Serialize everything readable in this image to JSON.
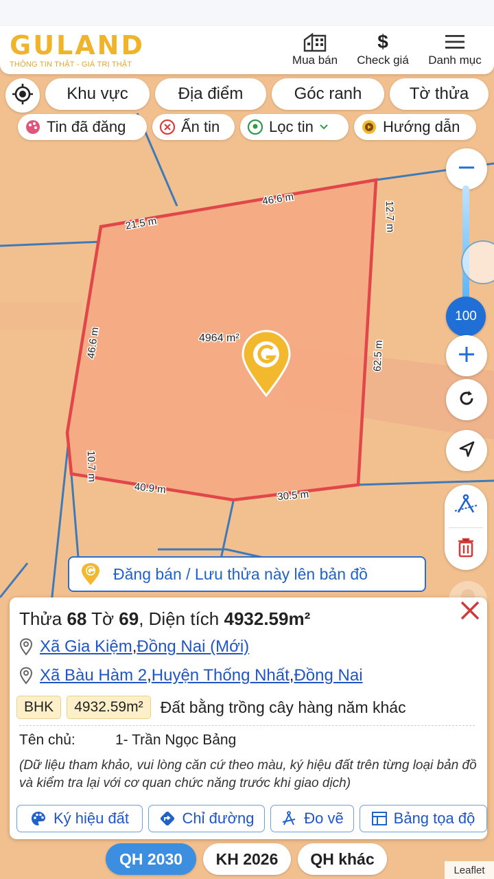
{
  "header": {
    "logo_text": "GULAND",
    "logo_tagline": "THÔNG TIN THẬT - GIÁ TRỊ THẬT",
    "nav": [
      {
        "label": "Mua bán",
        "icon": "building-icon"
      },
      {
        "label": "Check giá",
        "icon": "dollar-icon"
      },
      {
        "label": "Danh mục",
        "icon": "menu-icon"
      }
    ]
  },
  "filters": {
    "pills": [
      "Khu vực",
      "Địa điểm",
      "Góc ranh",
      "Tờ thửa"
    ],
    "chips": [
      {
        "label": "Tin đã đăng",
        "icon": "palette-icon"
      },
      {
        "label": "Ẩn tin",
        "icon": "close-circle-icon"
      },
      {
        "label": "Lọc tin",
        "icon": "location-pin-icon"
      },
      {
        "label": "Hướng dẫn",
        "icon": "play-circle-icon"
      }
    ]
  },
  "map": {
    "area_label": "4964 m²",
    "edges": [
      "46.6 m",
      "12.7 m",
      "21.5 m",
      "46.6 m",
      "62.5 m",
      "10.7 m",
      "40.9 m",
      "30.5 m"
    ],
    "zoom_level": "100",
    "parcel_color": "#f5a882",
    "parcel_border": "#e0464a",
    "attribution": "Leaflet"
  },
  "post_button": {
    "label": "Đăng bán / Lưu thửa này lên bản đồ"
  },
  "panel": {
    "title_prefix": "Thửa ",
    "plot_no": "68",
    "title_mid": " Tờ ",
    "sheet_no": "69",
    "title_area_label": ", Diện tích ",
    "area": "4932.59m²",
    "address_new": {
      "commune": "Xã Gia Kiệm",
      "sep": ", ",
      "province": "Đồng Nai (Mới)"
    },
    "address_old": {
      "commune": "Xã Bàu Hàm 2",
      "sep1": ", ",
      "district": "Huyện Thống Nhất",
      "sep2": ", ",
      "province": "Đồng Nai"
    },
    "land_code": "BHK",
    "land_area": "4932.59m²",
    "land_desc": "Đất bằng trồng cây hàng năm khác",
    "owner_label": "Tên chủ:",
    "owner_value": "1- Trần Ngọc Bảng",
    "note": "(Dữ liệu tham khảo, vui lòng căn cứ theo màu, ký hiệu đất trên từng loại bản đồ và kiểm tra lại với cơ quan chức năng trước khi giao dịch)",
    "actions": [
      {
        "label": "Ký hiệu đất",
        "icon": "palette-icon"
      },
      {
        "label": "Chỉ đường",
        "icon": "directions-icon"
      },
      {
        "label": "Đo vẽ",
        "icon": "compass-icon"
      },
      {
        "label": "Bảng tọa độ",
        "icon": "table-icon"
      }
    ]
  },
  "bottom_tabs": [
    {
      "label": "QH 2030",
      "active": true
    },
    {
      "label": "KH 2026",
      "active": false
    },
    {
      "label": "QH khác",
      "active": false
    }
  ],
  "colors": {
    "accent": "#f0b42a",
    "link": "#1f55c4",
    "active_tab": "#3b8ee0"
  }
}
